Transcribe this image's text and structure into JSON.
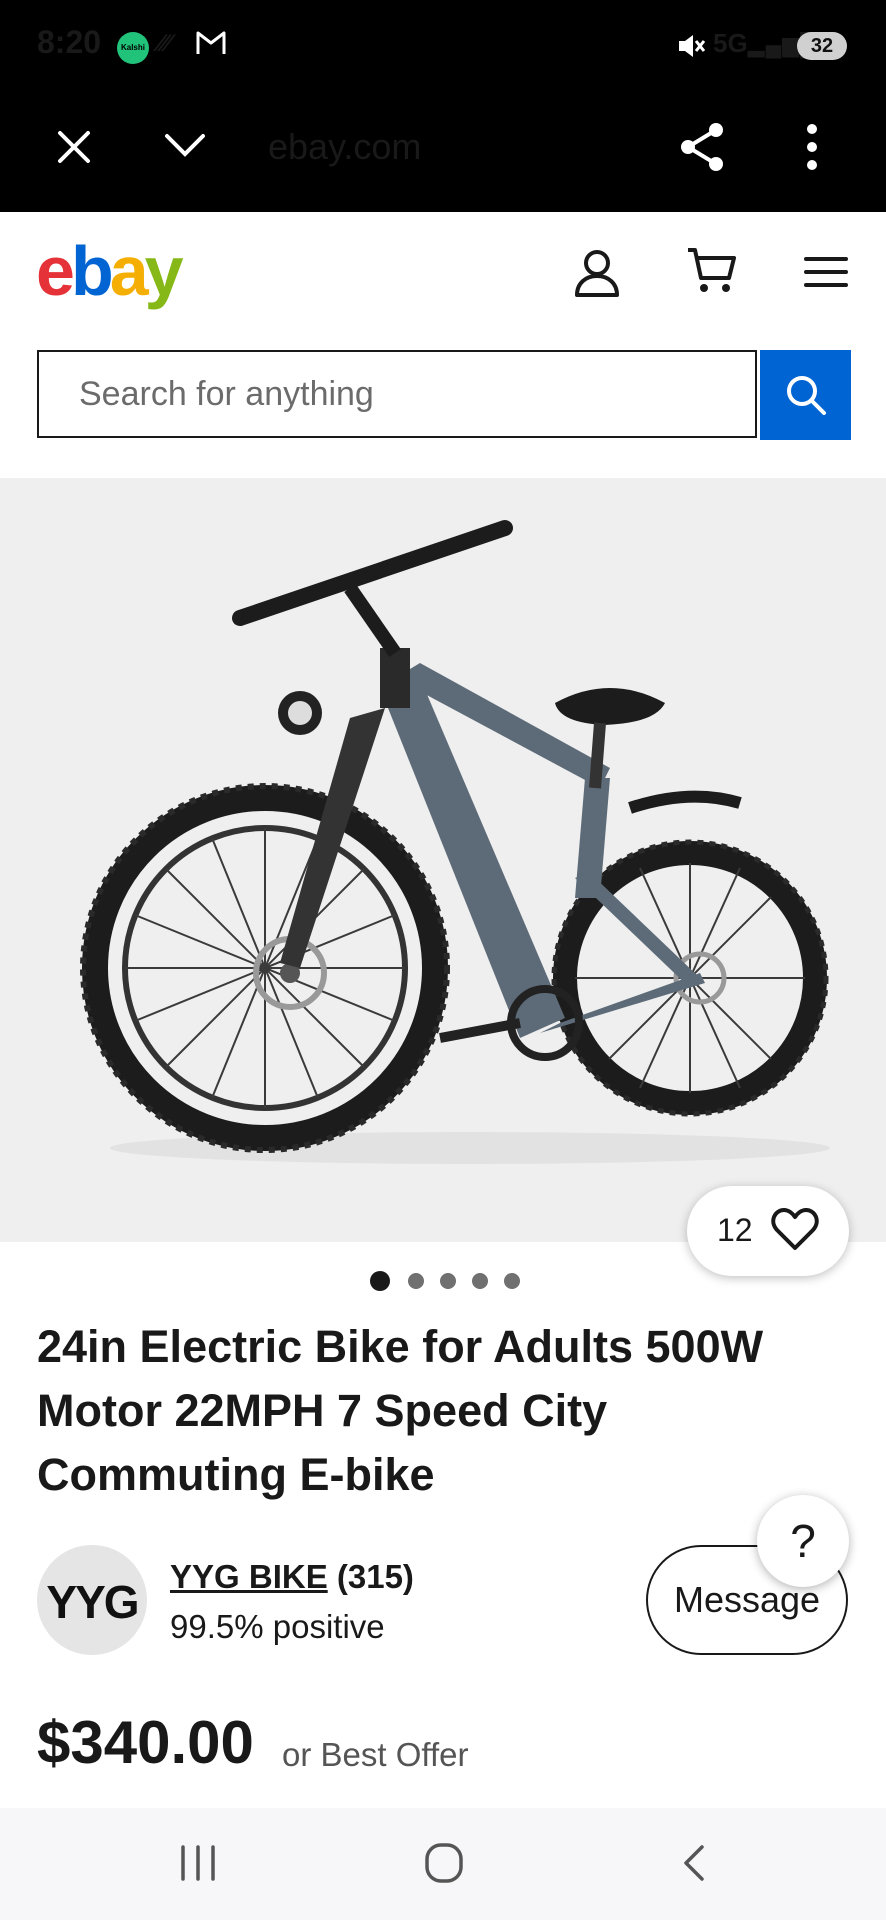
{
  "status_bar": {
    "time": "8:20",
    "kalshi_label": "Kalshi",
    "network": "5G",
    "battery": "32",
    "icons": [
      "kalshi-icon",
      "signal-slash-icon",
      "gmail-icon",
      "mute-icon",
      "signal-icon",
      "battery-icon"
    ]
  },
  "browser": {
    "url": "ebay.com",
    "icons": [
      "close-icon",
      "chevron-down-icon",
      "share-icon",
      "more-vert-icon"
    ]
  },
  "header": {
    "logo": {
      "e": "e",
      "b": "b",
      "a": "a",
      "y": "y"
    },
    "logo_colors": {
      "e": "#e53238",
      "b": "#0064d2",
      "a": "#f5af02",
      "y": "#86b817"
    },
    "icons": [
      "account-icon",
      "cart-icon",
      "menu-icon"
    ]
  },
  "search": {
    "placeholder": "Search for anything",
    "value": "",
    "button_color": "#0064d2"
  },
  "gallery": {
    "watch_count": "12",
    "image_count": 5,
    "active_index": 0
  },
  "product": {
    "title": "24in Electric Bike for Adults 500W Motor 22MPH 7 Speed City Commuting E-bike",
    "price": "$340.00",
    "offer": "or Best Offer"
  },
  "seller": {
    "avatar_text": "YYG",
    "name": "YYG BIKE",
    "count": " (315)",
    "feedback": "99.5% positive",
    "message_label": "Message"
  },
  "help_label": "?",
  "nav": {
    "icons": [
      "recent-apps-icon",
      "home-icon",
      "back-icon"
    ]
  }
}
